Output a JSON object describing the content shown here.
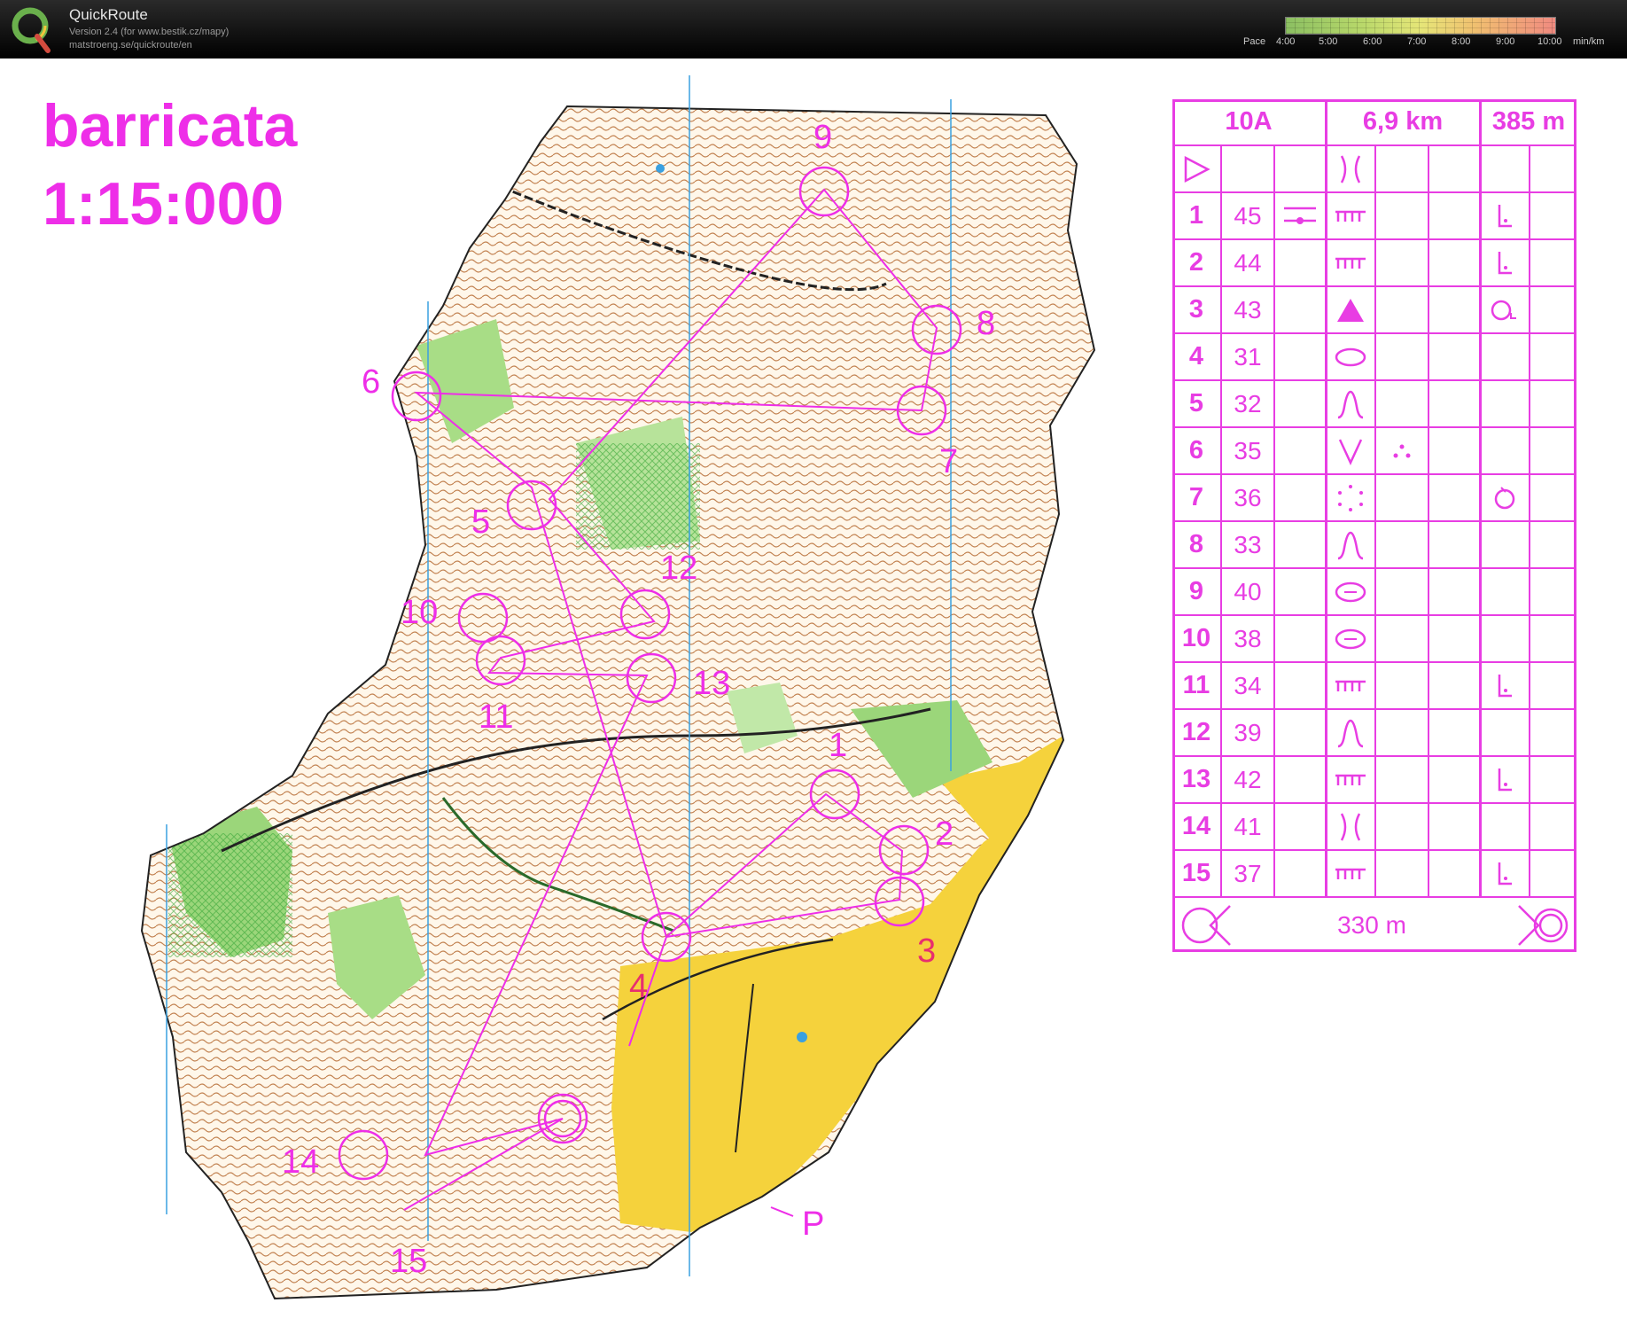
{
  "app": {
    "name": "QuickRoute",
    "version_line": "Version 2.4  (for www.bestik.cz/mapy)",
    "url_line": "matstroeng.se/quickroute/en"
  },
  "pace_legend": {
    "label": "Pace",
    "ticks": [
      "4:00",
      "5:00",
      "6:00",
      "7:00",
      "8:00",
      "9:00",
      "10:00"
    ],
    "unit": "min/km",
    "colors": [
      "#8bbf62",
      "#b8d86a",
      "#e6e678",
      "#f0c070",
      "#f08a80"
    ]
  },
  "map": {
    "title": "barricata",
    "scale": "1:15:000",
    "course_color": "#ee2ee8",
    "yellow_field_color": "#f5d23c",
    "forest_green_color": "#9bd67a",
    "contour_color": "#b8703a",
    "controls": [
      "1",
      "2",
      "3",
      "4",
      "5",
      "6",
      "7",
      "8",
      "9",
      "10",
      "11",
      "12",
      "13",
      "14",
      "15"
    ],
    "parking_label": "P"
  },
  "description_sheet": {
    "header": {
      "class": "10A",
      "length": "6,9 km",
      "climb": "385 m"
    },
    "rows": [
      {
        "n": "1",
        "code": "45",
        "feature": "ditch",
        "extra": "path-cross",
        "detail": "foot"
      },
      {
        "n": "2",
        "code": "44",
        "feature": "ditch",
        "extra": "",
        "detail": "foot"
      },
      {
        "n": "3",
        "code": "43",
        "feature": "boulder-triangle",
        "extra": "",
        "detail": "tree"
      },
      {
        "n": "4",
        "code": "31",
        "feature": "pit-oval",
        "extra": "",
        "detail": ""
      },
      {
        "n": "5",
        "code": "32",
        "feature": "spur",
        "extra": "",
        "detail": ""
      },
      {
        "n": "6",
        "code": "35",
        "feature": "reentrant",
        "extra": "dots",
        "detail": ""
      },
      {
        "n": "7",
        "code": "36",
        "feature": "dot-circle",
        "extra": "",
        "detail": "ring"
      },
      {
        "n": "8",
        "code": "33",
        "feature": "spur",
        "extra": "",
        "detail": ""
      },
      {
        "n": "9",
        "code": "40",
        "feature": "knoll",
        "extra": "",
        "detail": ""
      },
      {
        "n": "10",
        "code": "38",
        "feature": "knoll",
        "extra": "",
        "detail": ""
      },
      {
        "n": "11",
        "code": "34",
        "feature": "ditch",
        "extra": "",
        "detail": "foot"
      },
      {
        "n": "12",
        "code": "39",
        "feature": "spur",
        "extra": "",
        "detail": ""
      },
      {
        "n": "13",
        "code": "42",
        "feature": "ditch",
        "extra": "",
        "detail": "foot"
      },
      {
        "n": "14",
        "code": "41",
        "feature": "gap",
        "extra": "",
        "detail": ""
      },
      {
        "n": "15",
        "code": "37",
        "feature": "ditch",
        "extra": "",
        "detail": "foot"
      }
    ],
    "finish_distance": "330 m"
  }
}
